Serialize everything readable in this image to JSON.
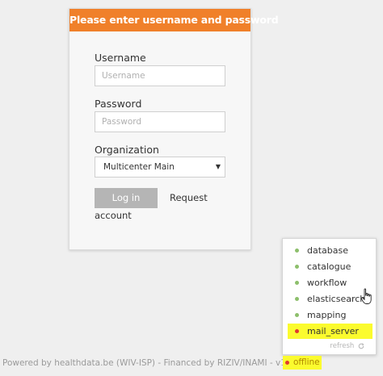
{
  "login": {
    "header": "Please enter username and password",
    "username_label": "Username",
    "username_placeholder": "Username",
    "password_label": "Password",
    "password_placeholder": "Password",
    "organization_label": "Organization",
    "organization_value": "Multicenter Main",
    "login_button": "Log in",
    "request_link_line1": "Request",
    "request_link_line2": "account"
  },
  "status_popup": {
    "items": [
      {
        "label": "database",
        "state": "ok",
        "color": "#8dbf6c"
      },
      {
        "label": "catalogue",
        "state": "ok",
        "color": "#8dbf6c"
      },
      {
        "label": "workflow",
        "state": "ok",
        "color": "#8dbf6c"
      },
      {
        "label": "elasticsearch",
        "state": "ok",
        "color": "#8dbf6c"
      },
      {
        "label": "mapping",
        "state": "ok",
        "color": "#8dbf6c"
      },
      {
        "label": "mail_server",
        "state": "error",
        "color": "#e03a2f"
      }
    ],
    "refresh_label": "refresh",
    "refresh_icon": "refresh-icon"
  },
  "footer": {
    "text": "Powered by healthdata.be (WIV-ISP) - Financed by RIZIV/INAMI - v1.9.0",
    "status_label": "offline",
    "status_color": "#e03a2f"
  },
  "colors": {
    "accent": "#f0802a",
    "highlight": "#fbfb2e",
    "ok": "#8dbf6c",
    "error": "#e03a2f"
  }
}
